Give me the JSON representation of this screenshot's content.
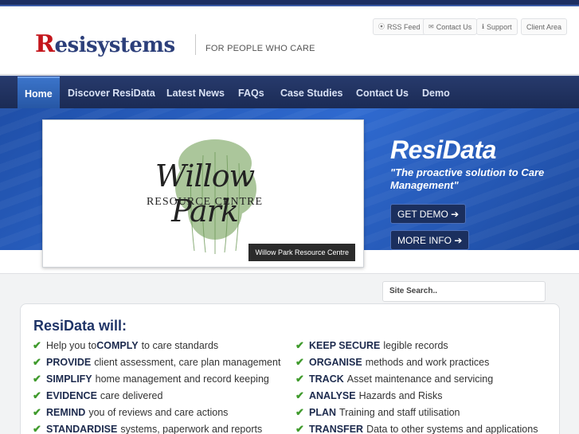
{
  "header": {
    "logo_first": "R",
    "logo_rest": "esisystems",
    "tagline": "FOR PEOPLE WHO CARE",
    "links": [
      {
        "label": "RSS Feed",
        "icon": "rss-icon"
      },
      {
        "label": "Contact Us",
        "icon": "mail-icon"
      },
      {
        "label": "Support",
        "icon": "info-icon"
      },
      {
        "label": "Client Area",
        "icon": ""
      }
    ]
  },
  "nav": {
    "items": [
      "Home",
      "Discover ResiData",
      "Latest News",
      "FAQs",
      "Case Studies",
      "Contact Us",
      "Demo"
    ],
    "active": "Home"
  },
  "slide": {
    "title": "Willow Park",
    "subtitle": "RESOURCE CENTRE",
    "caption": "Willow Park Resource Centre"
  },
  "hero": {
    "brand": "ResiData",
    "tagline": "\"The proactive solution to Care Management\"",
    "demo_button": "GET DEMO",
    "info_button": "MORE INFO"
  },
  "search": {
    "placeholder": "Site Search.."
  },
  "features": {
    "title": "ResiData will:",
    "left": [
      {
        "pre": "Help you to ",
        "bold": "COMPLY",
        "rest": " to care standards"
      },
      {
        "pre": "",
        "bold": "PROVIDE",
        "rest": "client assessment, care plan management"
      },
      {
        "pre": "",
        "bold": "SIMPLIFY",
        "rest": "home management and record keeping"
      },
      {
        "pre": "",
        "bold": "EVIDENCE",
        "rest": "care delivered"
      },
      {
        "pre": "",
        "bold": "REMIND",
        "rest": "you of reviews and care actions"
      },
      {
        "pre": "",
        "bold": "STANDARDISE",
        "rest": "systems, paperwork and reports"
      }
    ],
    "right": [
      {
        "pre": "",
        "bold": "KEEP SECURE",
        "rest": "legible records"
      },
      {
        "pre": "",
        "bold": "ORGANISE",
        "rest": "methods and work practices"
      },
      {
        "pre": "",
        "bold": "TRACK",
        "rest": "Asset maintenance and servicing"
      },
      {
        "pre": "",
        "bold": "ANALYSE",
        "rest": "Hazards and Risks"
      },
      {
        "pre": "",
        "bold": "PLAN",
        "rest": "Training and staff utilisation"
      },
      {
        "pre": "",
        "bold": "TRANSFER",
        "rest": "Data to other systems and applications"
      }
    ]
  },
  "colors": {
    "navy": "#1d2f63",
    "nav_active": "#2f63b9",
    "hero_blue": "#2a5fc0",
    "check_green": "#3f9a2c",
    "logo_red": "#c4161c"
  }
}
